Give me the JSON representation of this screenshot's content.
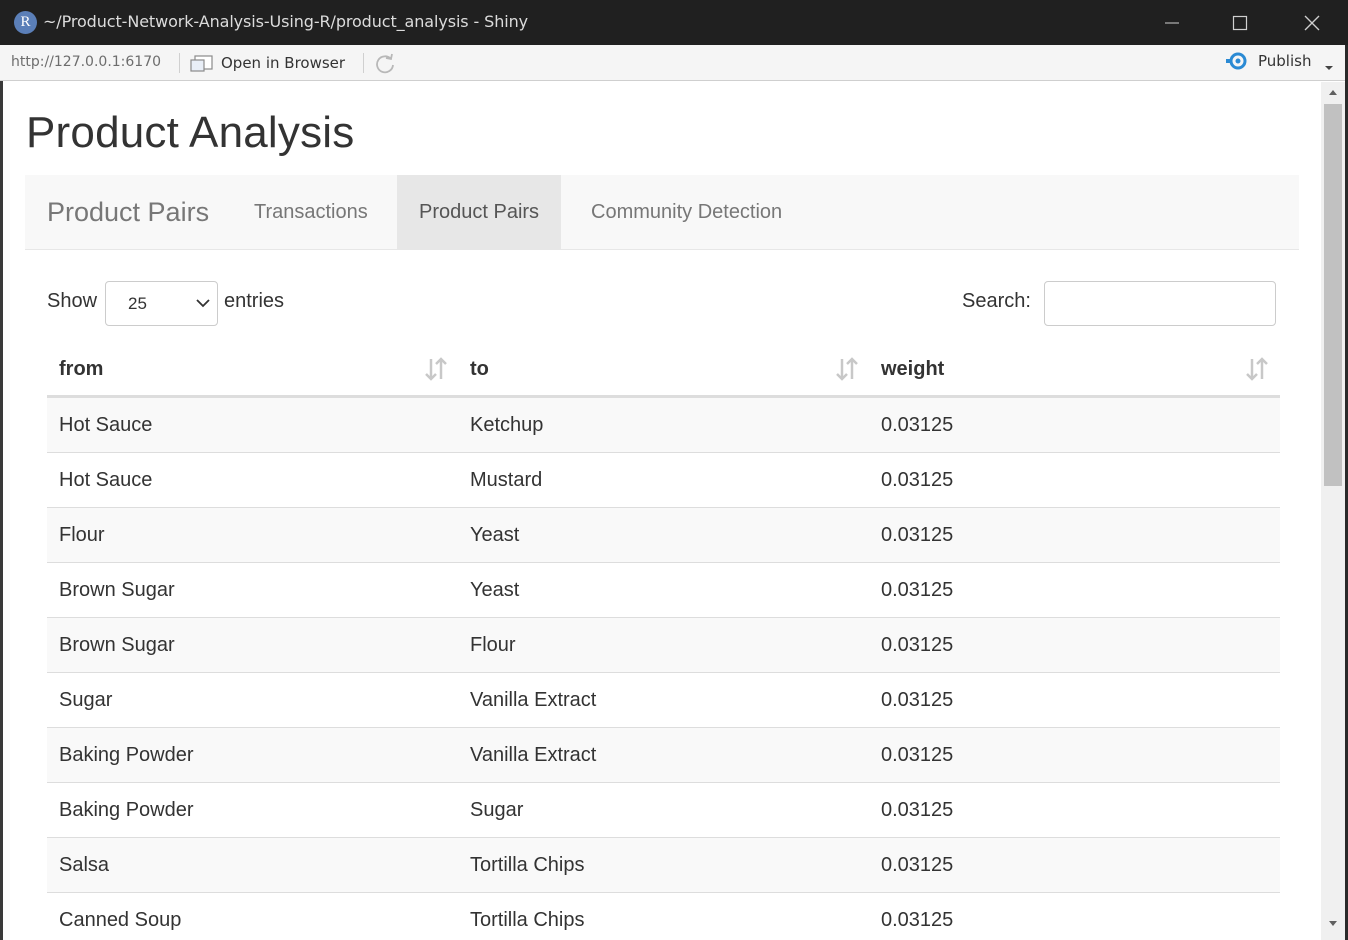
{
  "window": {
    "title": "~/Product-Network-Analysis-Using-R/product_analysis - Shiny",
    "logo_letter": "R"
  },
  "toolbar": {
    "url": "http://127.0.0.1:6170",
    "open_in_browser": "Open in Browser",
    "publish": "Publish"
  },
  "app": {
    "title": "Product Analysis",
    "navbar": {
      "brand": "Product Pairs",
      "tabs": [
        {
          "label": "Transactions",
          "active": false
        },
        {
          "label": "Product Pairs",
          "active": true
        },
        {
          "label": "Community Detection",
          "active": false
        }
      ]
    },
    "table_controls": {
      "show_label": "Show",
      "page_length": "25",
      "entries_label": "entries",
      "search_label": "Search:",
      "search_value": ""
    },
    "table": {
      "columns": [
        "from",
        "to",
        "weight"
      ],
      "rows": [
        [
          "Hot Sauce",
          "Ketchup",
          "0.03125"
        ],
        [
          "Hot Sauce",
          "Mustard",
          "0.03125"
        ],
        [
          "Flour",
          "Yeast",
          "0.03125"
        ],
        [
          "Brown Sugar",
          "Yeast",
          "0.03125"
        ],
        [
          "Brown Sugar",
          "Flour",
          "0.03125"
        ],
        [
          "Sugar",
          "Vanilla Extract",
          "0.03125"
        ],
        [
          "Baking Powder",
          "Vanilla Extract",
          "0.03125"
        ],
        [
          "Baking Powder",
          "Sugar",
          "0.03125"
        ],
        [
          "Salsa",
          "Tortilla Chips",
          "0.03125"
        ],
        [
          "Canned Soup",
          "Tortilla Chips",
          "0.03125"
        ]
      ]
    }
  },
  "colors": {
    "titlebar_bg": "#202020",
    "navbar_bg": "#f8f8f8",
    "active_tab_bg": "#e7e7e7",
    "publish_icon": "#2a8ad4",
    "striped_row": "#f9f9f9"
  }
}
